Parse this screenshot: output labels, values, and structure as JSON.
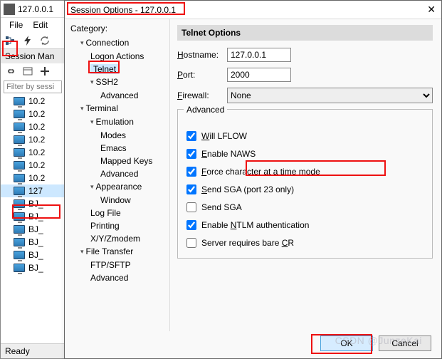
{
  "main": {
    "title": "127.0.0.1",
    "menu": [
      "File",
      "Edit"
    ],
    "session_mgr_label": "Session Man",
    "filter_placeholder": "Filter by sessi",
    "sessions": [
      "10.2",
      "10.2",
      "10.2",
      "10.2",
      "10.2",
      "10.2",
      "10.2",
      "127",
      "BJ_",
      "BJ_",
      "BJ_",
      "BJ_",
      "BJ_",
      "BJ_"
    ],
    "selected_index": 7,
    "status": "Ready"
  },
  "dialog": {
    "title": "Session Options - 127.0.0.1",
    "category_label": "Category:",
    "tree": {
      "connection": "Connection",
      "logon_actions": "Logon Actions",
      "telnet": "Telnet",
      "ssh2": "SSH2",
      "ssh2_advanced": "Advanced",
      "terminal": "Terminal",
      "emulation": "Emulation",
      "modes": "Modes",
      "emacs": "Emacs",
      "mapped_keys": "Mapped Keys",
      "emul_advanced": "Advanced",
      "appearance": "Appearance",
      "window": "Window",
      "log_file": "Log File",
      "printing": "Printing",
      "xyz": "X/Y/Zmodem",
      "file_transfer": "File Transfer",
      "ftp": "FTP/SFTP",
      "ft_advanced": "Advanced"
    },
    "right": {
      "header": "Telnet Options",
      "hostname_label": "Hostname:",
      "hostname_value": "127.0.0.1",
      "port_label": "Port:",
      "port_value": "2000",
      "firewall_label": "Firewall:",
      "firewall_value": "None",
      "advanced_label": "Advanced",
      "checks": {
        "will_lflow": {
          "label": "Will LFLOW",
          "checked": true
        },
        "enable_naws": {
          "label": "Enable NAWS",
          "checked": true
        },
        "force_char": {
          "label": "Force character at a time mode",
          "checked": true
        },
        "send_sga_23": {
          "label": "Send SGA (port 23 only)",
          "checked": true
        },
        "send_sga": {
          "label": "Send SGA",
          "checked": false
        },
        "ntlm": {
          "label": "Enable NTLM authentication",
          "checked": true
        },
        "bare_cr": {
          "label": "Server requires bare CR",
          "checked": false
        }
      }
    },
    "buttons": {
      "ok": "OK",
      "cancel": "Cancel"
    }
  },
  "watermark": "CSDN @JunzeKai"
}
